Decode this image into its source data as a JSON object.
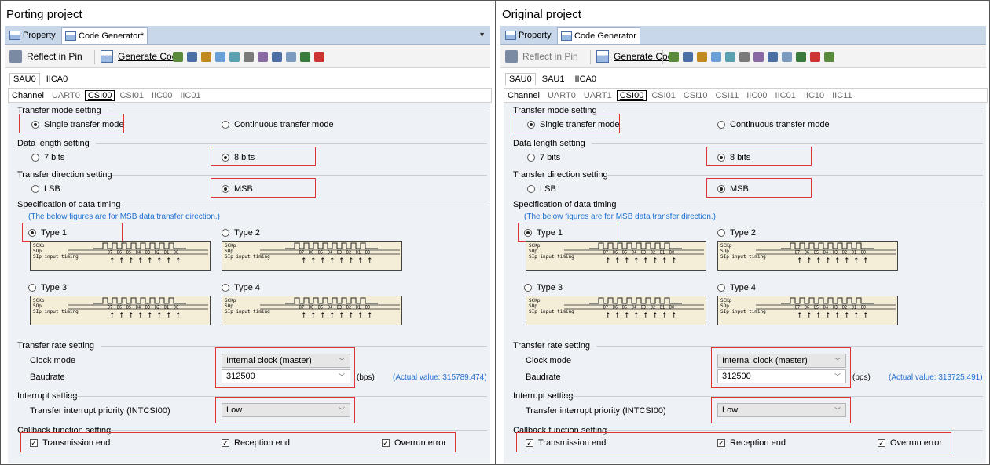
{
  "panels": [
    {
      "title": "Porting project",
      "tabs": [
        "Property",
        "Code Generator*"
      ],
      "toolbar": {
        "reflect": "Reflect in Pin",
        "generate": "Generate Code"
      },
      "unit_tabs": [
        "SAU0",
        "IICA0"
      ],
      "channel_tabs": [
        "Channel",
        "UART0",
        "CSI00",
        "CSI01",
        "IIC00",
        "IIC01"
      ],
      "transfer_mode": {
        "title": "Transfer mode setting",
        "opt1": "Single transfer mode",
        "opt2": "Continuous transfer mode"
      },
      "data_length": {
        "title": "Data length setting",
        "opt1": "7 bits",
        "opt2": "8 bits"
      },
      "direction": {
        "title": "Transfer direction setting",
        "opt1": "LSB",
        "opt2": "MSB"
      },
      "timing": {
        "title": "Specification of data timing",
        "note": "(The below figures are for MSB data transfer direction.)",
        "type1": "Type 1",
        "type2": "Type 2",
        "type3": "Type 3",
        "type4": "Type 4"
      },
      "rate": {
        "title": "Transfer rate setting",
        "clock_label": "Clock mode",
        "clock_value": "Internal clock (master)",
        "baud_label": "Baudrate",
        "baud_value": "312500",
        "unit": "(bps)",
        "actual": "(Actual value: 315789.474)"
      },
      "interrupt": {
        "title": "Interrupt setting",
        "label": "Transfer interrupt priority (INTCSI00)",
        "value": "Low"
      },
      "callback": {
        "title": "Callback function setting",
        "c1": "Transmission end",
        "c2": "Reception end",
        "c3": "Overrun error"
      }
    },
    {
      "title": "Original project",
      "tabs": [
        "Property",
        "Code Generator"
      ],
      "toolbar": {
        "reflect": "Reflect in Pin",
        "generate": "Generate Code"
      },
      "unit_tabs": [
        "SAU0",
        "SAU1",
        "IICA0"
      ],
      "channel_tabs": [
        "Channel",
        "UART0",
        "UART1",
        "CSI00",
        "CSI01",
        "CSI10",
        "CSI11",
        "IIC00",
        "IIC01",
        "IIC10",
        "IIC11"
      ],
      "transfer_mode": {
        "title": "Transfer mode setting",
        "opt1": "Single transfer mode",
        "opt2": "Continuous transfer mode"
      },
      "data_length": {
        "title": "Data length setting",
        "opt1": "7 bits",
        "opt2": "8 bits"
      },
      "direction": {
        "title": "Transfer direction setting",
        "opt1": "LSB",
        "opt2": "MSB"
      },
      "timing": {
        "title": "Specification of data timing",
        "note": "(The below figures are for MSB data transfer direction.)",
        "type1": "Type 1",
        "type2": "Type 2",
        "type3": "Type 3",
        "type4": "Type 4"
      },
      "rate": {
        "title": "Transfer rate setting",
        "clock_label": "Clock mode",
        "clock_value": "Internal clock (master)",
        "baud_label": "Baudrate",
        "baud_value": "312500",
        "unit": "(bps)",
        "actual": "(Actual value: 313725.491)"
      },
      "interrupt": {
        "title": "Interrupt setting",
        "label": "Transfer interrupt priority (INTCSI00)",
        "value": "Low"
      },
      "callback": {
        "title": "Callback function setting",
        "c1": "Transmission end",
        "c2": "Reception end",
        "c3": "Overrun error"
      }
    }
  ],
  "timing_diagram": {
    "sck": "SCKp",
    "so": "SOp",
    "si": "SIp input timing",
    "bits": [
      "D7",
      "D6",
      "D5",
      "D4",
      "D3",
      "D2",
      "D1",
      "D0"
    ]
  },
  "colors": {
    "highlight": "#dd3333",
    "note": "#1f6fd1",
    "tabbar": "#c9d7ea",
    "content_bg": "#eef1f5"
  }
}
